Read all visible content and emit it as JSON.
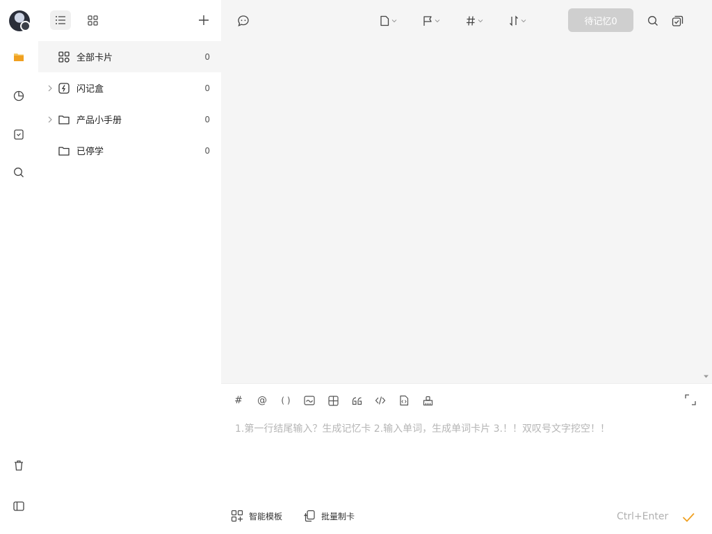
{
  "rail": {
    "icons": [
      "folder-icon",
      "stats-pie-icon",
      "calendar-icon",
      "search-icon",
      "trash-icon",
      "sidebar-toggle-icon"
    ]
  },
  "sidebar": {
    "view_list_icon": "list-view-icon",
    "view_grid_icon": "grid-view-icon",
    "add_icon": "plus-icon",
    "items": [
      {
        "label": "全部卡片",
        "count": "0",
        "icon": "grid-cards-icon",
        "expandable": false,
        "active": true
      },
      {
        "label": "闪记盒",
        "count": "0",
        "icon": "flash-box-icon",
        "expandable": true,
        "active": false
      },
      {
        "label": "产品小手册",
        "count": "0",
        "icon": "folder-icon",
        "expandable": true,
        "active": false
      },
      {
        "label": "已停学",
        "count": "0",
        "icon": "folder-icon",
        "expandable": false,
        "active": false
      }
    ]
  },
  "topbar": {
    "chat_icon": "chat-icon",
    "filters": [
      "card-type-icon",
      "flag-icon",
      "hashtag-icon",
      "sort-icon"
    ],
    "review_button": "待记忆0",
    "search_icon": "search-icon",
    "multi_select_icon": "multi-select-icon"
  },
  "editor": {
    "tools": [
      "#",
      "@",
      "( )",
      "image-icon",
      "table-icon",
      "quote-icon",
      "code-icon",
      "file-code-icon",
      "clear-format-icon"
    ],
    "placeholder": "1.第一行结尾输入？生成记忆卡 2.输入单词，生成单词卡片 3.！！双叹号文字挖空！！",
    "smart_template": "智能模板",
    "batch_create": "批量制卡",
    "shortcut": "Ctrl+Enter"
  },
  "colors": {
    "accent": "#f0a020",
    "review_button_bg": "#cfcfcf",
    "main_bg": "#f5f5f5"
  }
}
